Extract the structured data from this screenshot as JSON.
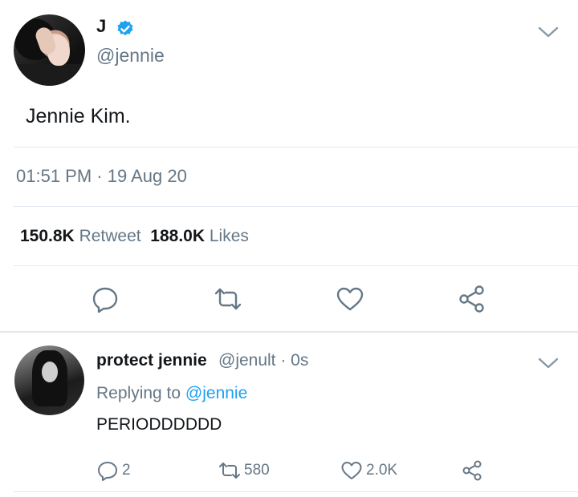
{
  "tweet": {
    "display_name": "J",
    "handle": "@jennie",
    "text": "Jennie Kim.",
    "timestamp": "01:51 PM · 19 Aug 20",
    "retweets_count": "150.8K",
    "retweets_label": "Retweet",
    "likes_count": "188.0K",
    "likes_label": "Likes",
    "actions": [
      "reply-icon",
      "retweet-icon",
      "like-icon",
      "share-icon"
    ]
  },
  "reply": {
    "display_name": "protect jennie",
    "handle_time": "@jenult · 0s",
    "replying_prefix": "Replying to",
    "replying_to": "@jennie",
    "text": "PERIODDDDDD",
    "reply_count": "2",
    "retweet_count": "580",
    "like_count": "2.0K"
  },
  "colors": {
    "accent": "#1da1f2",
    "secondary_text": "#657786",
    "divider": "#e1e8ed"
  }
}
